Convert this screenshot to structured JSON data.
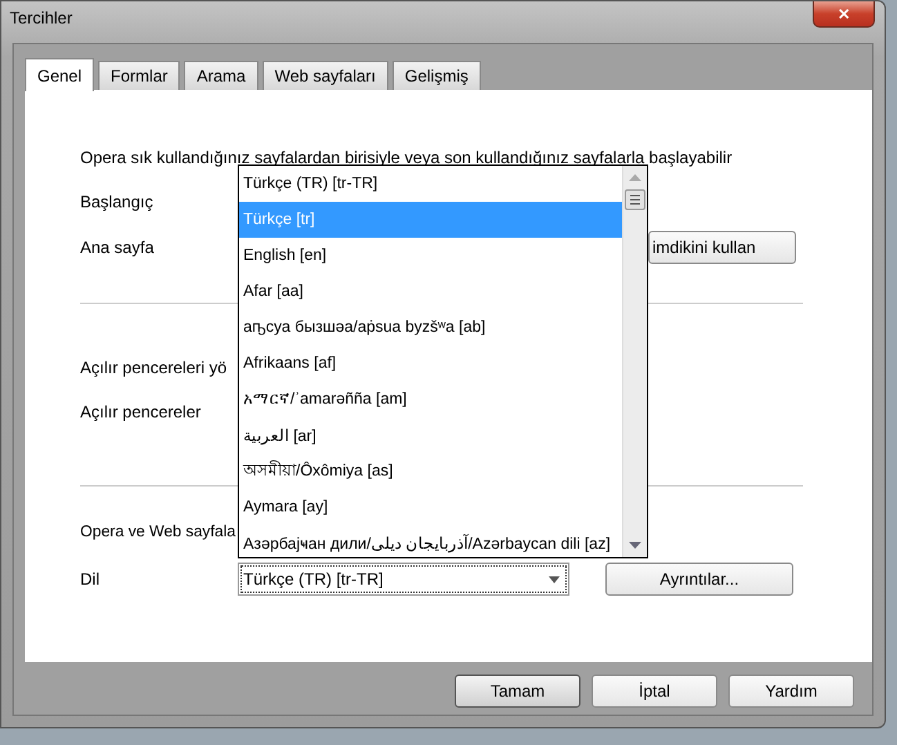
{
  "window": {
    "title": "Tercihler",
    "close": "✕"
  },
  "tabs": [
    {
      "label": "Genel",
      "selected": true
    },
    {
      "label": "Formlar",
      "selected": false
    },
    {
      "label": "Arama",
      "selected": false
    },
    {
      "label": "Web sayfaları",
      "selected": false
    },
    {
      "label": "Gelişmiş",
      "selected": false
    }
  ],
  "panel": {
    "intro": "Opera sık kullandığınız sayfalardan birisiyle veya son kullandığınız sayfalarla başlayabilir",
    "startup_label": "Başlangıç",
    "home_label": "Ana sayfa",
    "home_button": "imdikini kullan",
    "popup_labels": [
      "Açılır pencereleri yö",
      "Açılır pencereler"
    ],
    "language_intro": "Opera ve Web sayfala",
    "language_label": "Dil",
    "language_value": "Türkçe (TR) [tr-TR]",
    "details_button": "Ayrıntılar..."
  },
  "dropdown": {
    "expanded": true,
    "items": [
      {
        "label": "Türkçe (TR) [tr-TR]",
        "selected": false
      },
      {
        "label": "Türkçe [tr]",
        "selected": true
      },
      {
        "label": "English [en]",
        "selected": false
      },
      {
        "label": "Afar [aa]",
        "selected": false
      },
      {
        "label": "аҧсуа бызшәа/aṗsua byzšʷa [ab]",
        "selected": false
      },
      {
        "label": "Afrikaans [af]",
        "selected": false
      },
      {
        "label": "አማርኛ/ʾamarəñña [am]",
        "selected": false
      },
      {
        "label": "العربية [ar]",
        "selected": false
      },
      {
        "label": "অসমীয়া/Ôxômiya [as]",
        "selected": false
      },
      {
        "label": "Aymara [ay]",
        "selected": false
      },
      {
        "label": "Азәрбајҹан дили/آذربایجان دیلی/Azərbaycan dili [az]",
        "selected": false
      }
    ]
  },
  "buttons": [
    {
      "label": "Tamam",
      "default": true
    },
    {
      "label": "İptal",
      "default": false
    },
    {
      "label": "Yardım",
      "default": false
    }
  ]
}
